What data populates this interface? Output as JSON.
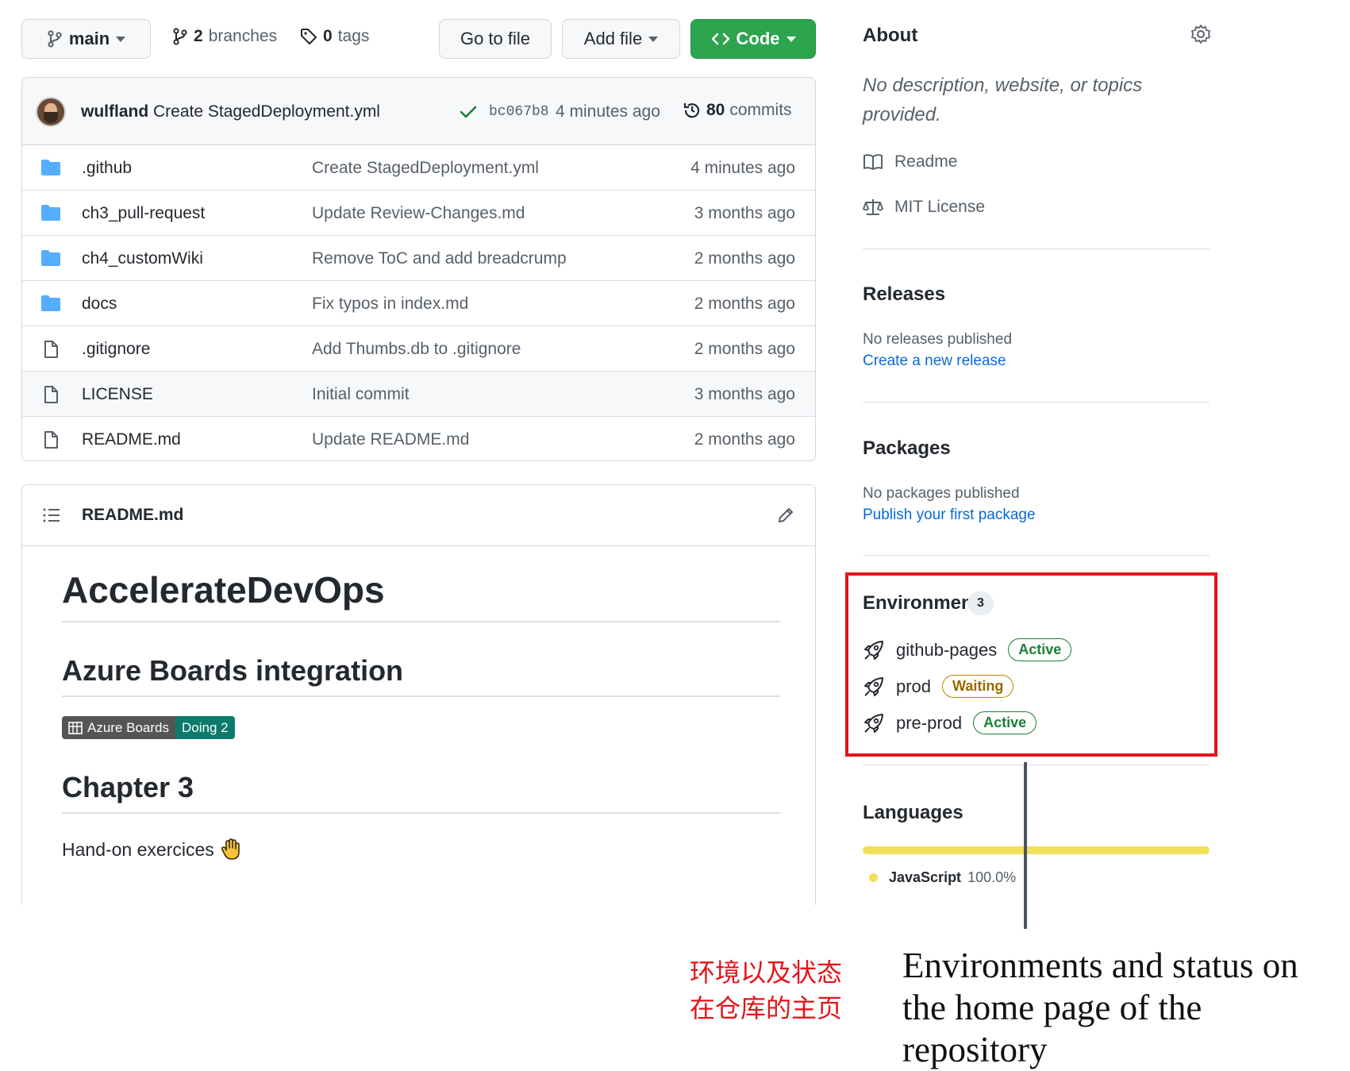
{
  "toolbar": {
    "branch": "main",
    "branches_count": "2",
    "branches_label": "branches",
    "tags_count": "0",
    "tags_label": "tags",
    "go_to_file": "Go to file",
    "add_file": "Add file",
    "code": "Code"
  },
  "commit": {
    "author": "wulfland",
    "message": "Create StagedDeployment.yml",
    "sha": "bc067b8",
    "time": "4 minutes ago",
    "commits_count": "80",
    "commits_label": "commits"
  },
  "files": [
    {
      "name": ".github",
      "type": "folder",
      "message": "Create StagedDeployment.yml",
      "age": "4 minutes ago"
    },
    {
      "name": "ch3_pull-request",
      "type": "folder",
      "message": "Update Review-Changes.md",
      "age": "3 months ago"
    },
    {
      "name": "ch4_customWiki",
      "type": "folder",
      "message": "Remove ToC and add breadcrump",
      "age": "2 months ago"
    },
    {
      "name": "docs",
      "type": "folder",
      "message": "Fix typos in index.md",
      "age": "2 months ago"
    },
    {
      "name": ".gitignore",
      "type": "file",
      "message": "Add Thumbs.db to .gitignore",
      "age": "2 months ago"
    },
    {
      "name": "LICENSE",
      "type": "file",
      "message": "Initial commit",
      "age": "3 months ago"
    },
    {
      "name": "README.md",
      "type": "file",
      "message": "Update README.md",
      "age": "2 months ago"
    }
  ],
  "readme": {
    "file_name": "README.md",
    "h1": "AccelerateDevOps",
    "h2_boards": "Azure Boards integration",
    "badge_left": "Azure Boards",
    "badge_right": "Doing 2",
    "h2_chapter": "Chapter 3",
    "paragraph": "Hand-on exercices"
  },
  "sidebar": {
    "about_title": "About",
    "about_desc": "No description, website, or topics provided.",
    "readme_link": "Readme",
    "license_link": "MIT License",
    "releases_title": "Releases",
    "releases_none": "No releases published",
    "releases_link": "Create a new release",
    "packages_title": "Packages",
    "packages_none": "No packages published",
    "packages_link": "Publish your first package",
    "environments_title": "Environments",
    "environments_count": "3",
    "environments": [
      {
        "name": "github-pages",
        "state": "Active"
      },
      {
        "name": "prod",
        "state": "Waiting"
      },
      {
        "name": "pre-prod",
        "state": "Active"
      }
    ],
    "languages_title": "Languages",
    "language_name": "JavaScript",
    "language_pct": "100.0%",
    "language_fraction": 1.0
  },
  "colors": {
    "code_button": "#2da44e",
    "link": "#0969da",
    "active": "#1a7f37",
    "waiting": "#9a6700",
    "highlight": "#e3141b",
    "javascript": "#f1e05a"
  },
  "caption": {
    "zh_line1": "环境以及状态",
    "zh_line2": "在仓库的主页",
    "en": "Environments and status on the home page of the repository"
  }
}
